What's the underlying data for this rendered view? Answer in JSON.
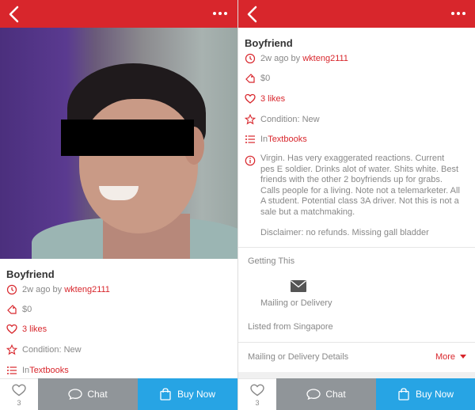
{
  "listing": {
    "title": "Boyfriend",
    "time_ago": "2w ago by ",
    "seller": "wkteng2111",
    "price": "$0",
    "likes": "3 likes",
    "condition": "Condition: New",
    "category_prefix": "In ",
    "category": "Textbooks",
    "description": "Virgin. Has very exaggerated reactions. Current pes E soldier. Drinks alot of water. Shits white. Best friends with the other 2 boyfriends up for grabs. Calls people for a living. Note not a telemarketer. All A student. Potential class 3A driver. Not this is not a sale but a matchmaking.",
    "disclaimer": "Disclaimer: no refunds. Missing gall bladder"
  },
  "getting": {
    "heading": "Getting This",
    "mailing_label": "Mailing or Delivery",
    "listed_from": "Listed from Singapore",
    "details_label": "Mailing or Delivery Details",
    "more_label": "More"
  },
  "bottom_bar": {
    "like_count": "3",
    "chat_label": "Chat",
    "buy_label": "Buy Now"
  },
  "icons": {
    "back": "chevron-left-icon",
    "more": "more-dots-icon",
    "clock": "clock-icon",
    "tag": "price-tag-icon",
    "heart": "heart-icon",
    "star": "star-icon",
    "list": "list-icon",
    "info": "info-icon",
    "mail": "mail-icon",
    "chat": "chat-bubble-icon",
    "bag": "shopping-bag-icon"
  },
  "colors": {
    "brand_red": "#d8262c",
    "chat_grey": "#909599",
    "buy_blue": "#27a4e4"
  }
}
